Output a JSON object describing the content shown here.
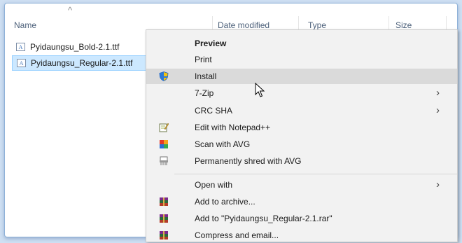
{
  "columns": {
    "name": "Name",
    "date_modified": "Date modified",
    "type": "Type",
    "size": "Size"
  },
  "files": [
    {
      "name": "Pyidaungsu_Bold-2.1.ttf",
      "selected": false
    },
    {
      "name": "Pyidaungsu_Regular-2.1.ttf",
      "selected": true
    }
  ],
  "menu": {
    "preview": "Preview",
    "print": "Print",
    "install": "Install",
    "sevenzip": "7-Zip",
    "crc": "CRC SHA",
    "notepad": "Edit with Notepad++",
    "scan_avg": "Scan with AVG",
    "shred_avg": "Permanently shred with AVG",
    "open_with": "Open with",
    "add_archive": "Add to archive...",
    "add_rar": "Add to \"Pyidaungsu_Regular-2.1.rar\"",
    "compress_email": "Compress and email..."
  },
  "icons": {
    "file": "font-file-icon",
    "install": "shield-icon",
    "notepad": "notepad-icon",
    "avg": "avg-icon",
    "shred": "shredder-icon",
    "winrar": "winrar-icon"
  },
  "colors": {
    "selection": "#cce8ff",
    "menu_hover": "#dadada",
    "menu_bg": "#f2f2f2"
  }
}
